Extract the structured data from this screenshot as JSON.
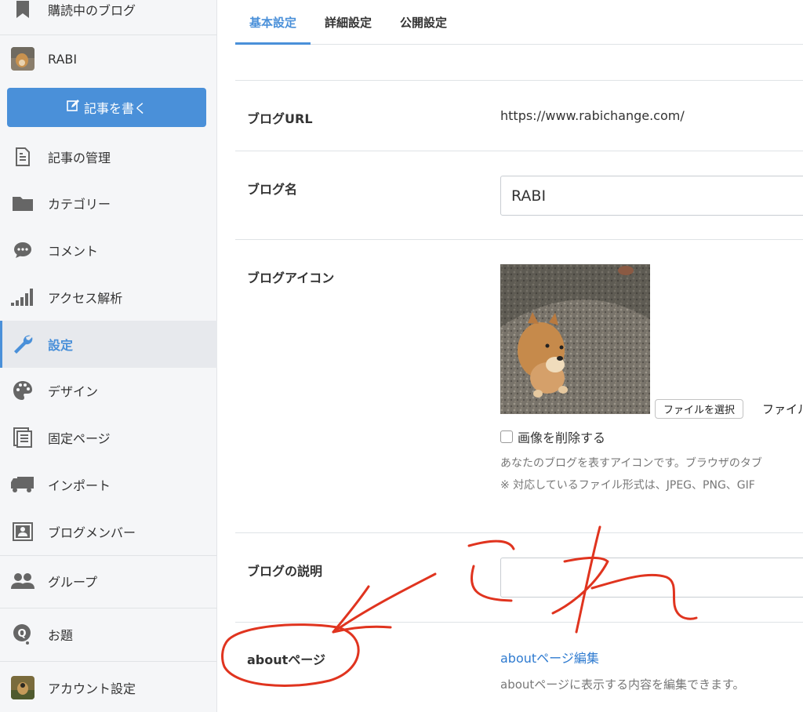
{
  "sidebar": {
    "subscribed_label": "購読中のブログ",
    "blog_name": "RABI",
    "write_button": "記事を書く",
    "items": [
      {
        "label": "記事の管理",
        "icon": "document-icon"
      },
      {
        "label": "カテゴリー",
        "icon": "folder-icon"
      },
      {
        "label": "コメント",
        "icon": "comment-icon"
      },
      {
        "label": "アクセス解析",
        "icon": "bar-chart-icon"
      },
      {
        "label": "設定",
        "icon": "wrench-icon"
      },
      {
        "label": "デザイン",
        "icon": "palette-icon"
      },
      {
        "label": "固定ページ",
        "icon": "pages-icon"
      },
      {
        "label": "インポート",
        "icon": "truck-icon"
      },
      {
        "label": "ブログメンバー",
        "icon": "member-icon"
      }
    ],
    "group_label": "グループ",
    "odai_label": "お題",
    "account_label": "アカウント設定",
    "accent_color": "#4a90d9"
  },
  "tabs": [
    {
      "label": "基本設定"
    },
    {
      "label": "詳細設定"
    },
    {
      "label": "公開設定"
    }
  ],
  "settings": {
    "url_label": "ブログURL",
    "url_value": "https://www.rabichange.com/",
    "name_label": "ブログ名",
    "name_value": "RABI",
    "icon_label": "ブログアイコン",
    "file_button": "ファイルを選択",
    "file_status": "ファイル",
    "delete_image_label": "画像を削除する",
    "icon_help_1": "あなたのブログを表すアイコンです。ブラウザのタブ",
    "icon_help_2": "※ 対応しているファイル形式は、JPEG、PNG、GIF",
    "description_label": "ブログの説明",
    "description_value": "",
    "about_label": "aboutページ",
    "about_link": "aboutページ編集",
    "about_help": "aboutページに表示する内容を編集できます。"
  },
  "annotation": {
    "handwritten_text": "これ",
    "color": "#e0341f"
  }
}
